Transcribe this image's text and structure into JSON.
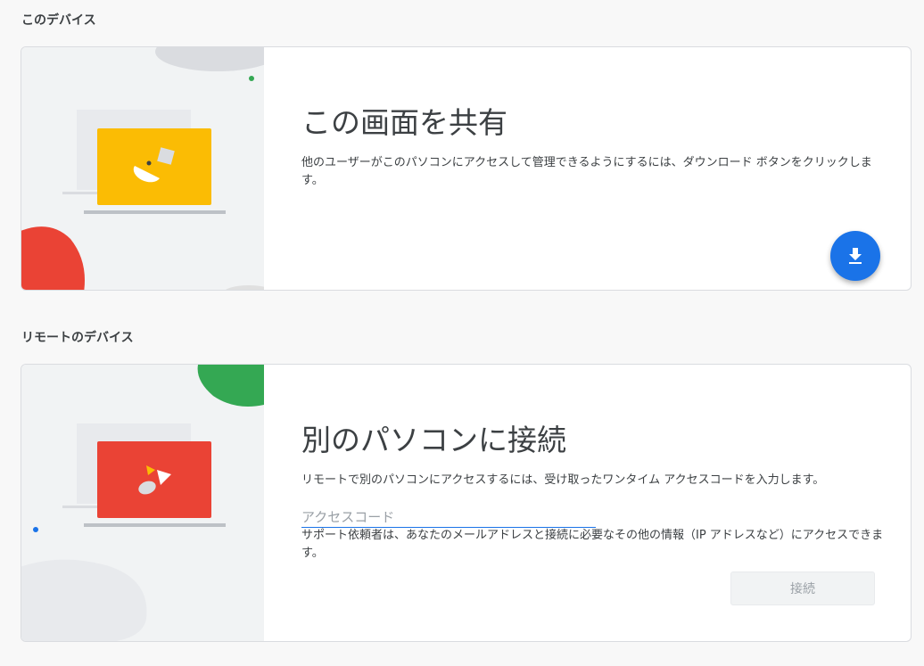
{
  "this_device": {
    "section_label": "このデバイス",
    "title": "この画面を共有",
    "description": "他のユーザーがこのパソコンにアクセスして管理できるようにするには、ダウンロード ボタンをクリックします。",
    "download_icon": "download-icon"
  },
  "remote_device": {
    "section_label": "リモートのデバイス",
    "title": "別のパソコンに接続",
    "description": "リモートで別のパソコンにアクセスするには、受け取ったワンタイム アクセスコードを入力します。",
    "access_code_placeholder": "アクセスコード",
    "access_code_value": "",
    "helper_text": "サポート依頼者は、あなたのメールアドレスと接続に必要なその他の情報（IP アドレスなど）にアクセスできます。",
    "connect_label": "接続"
  },
  "colors": {
    "accent_blue": "#1a73e8",
    "share_yellow": "#fbbc04",
    "remote_red": "#ea4335",
    "green": "#34a853"
  }
}
